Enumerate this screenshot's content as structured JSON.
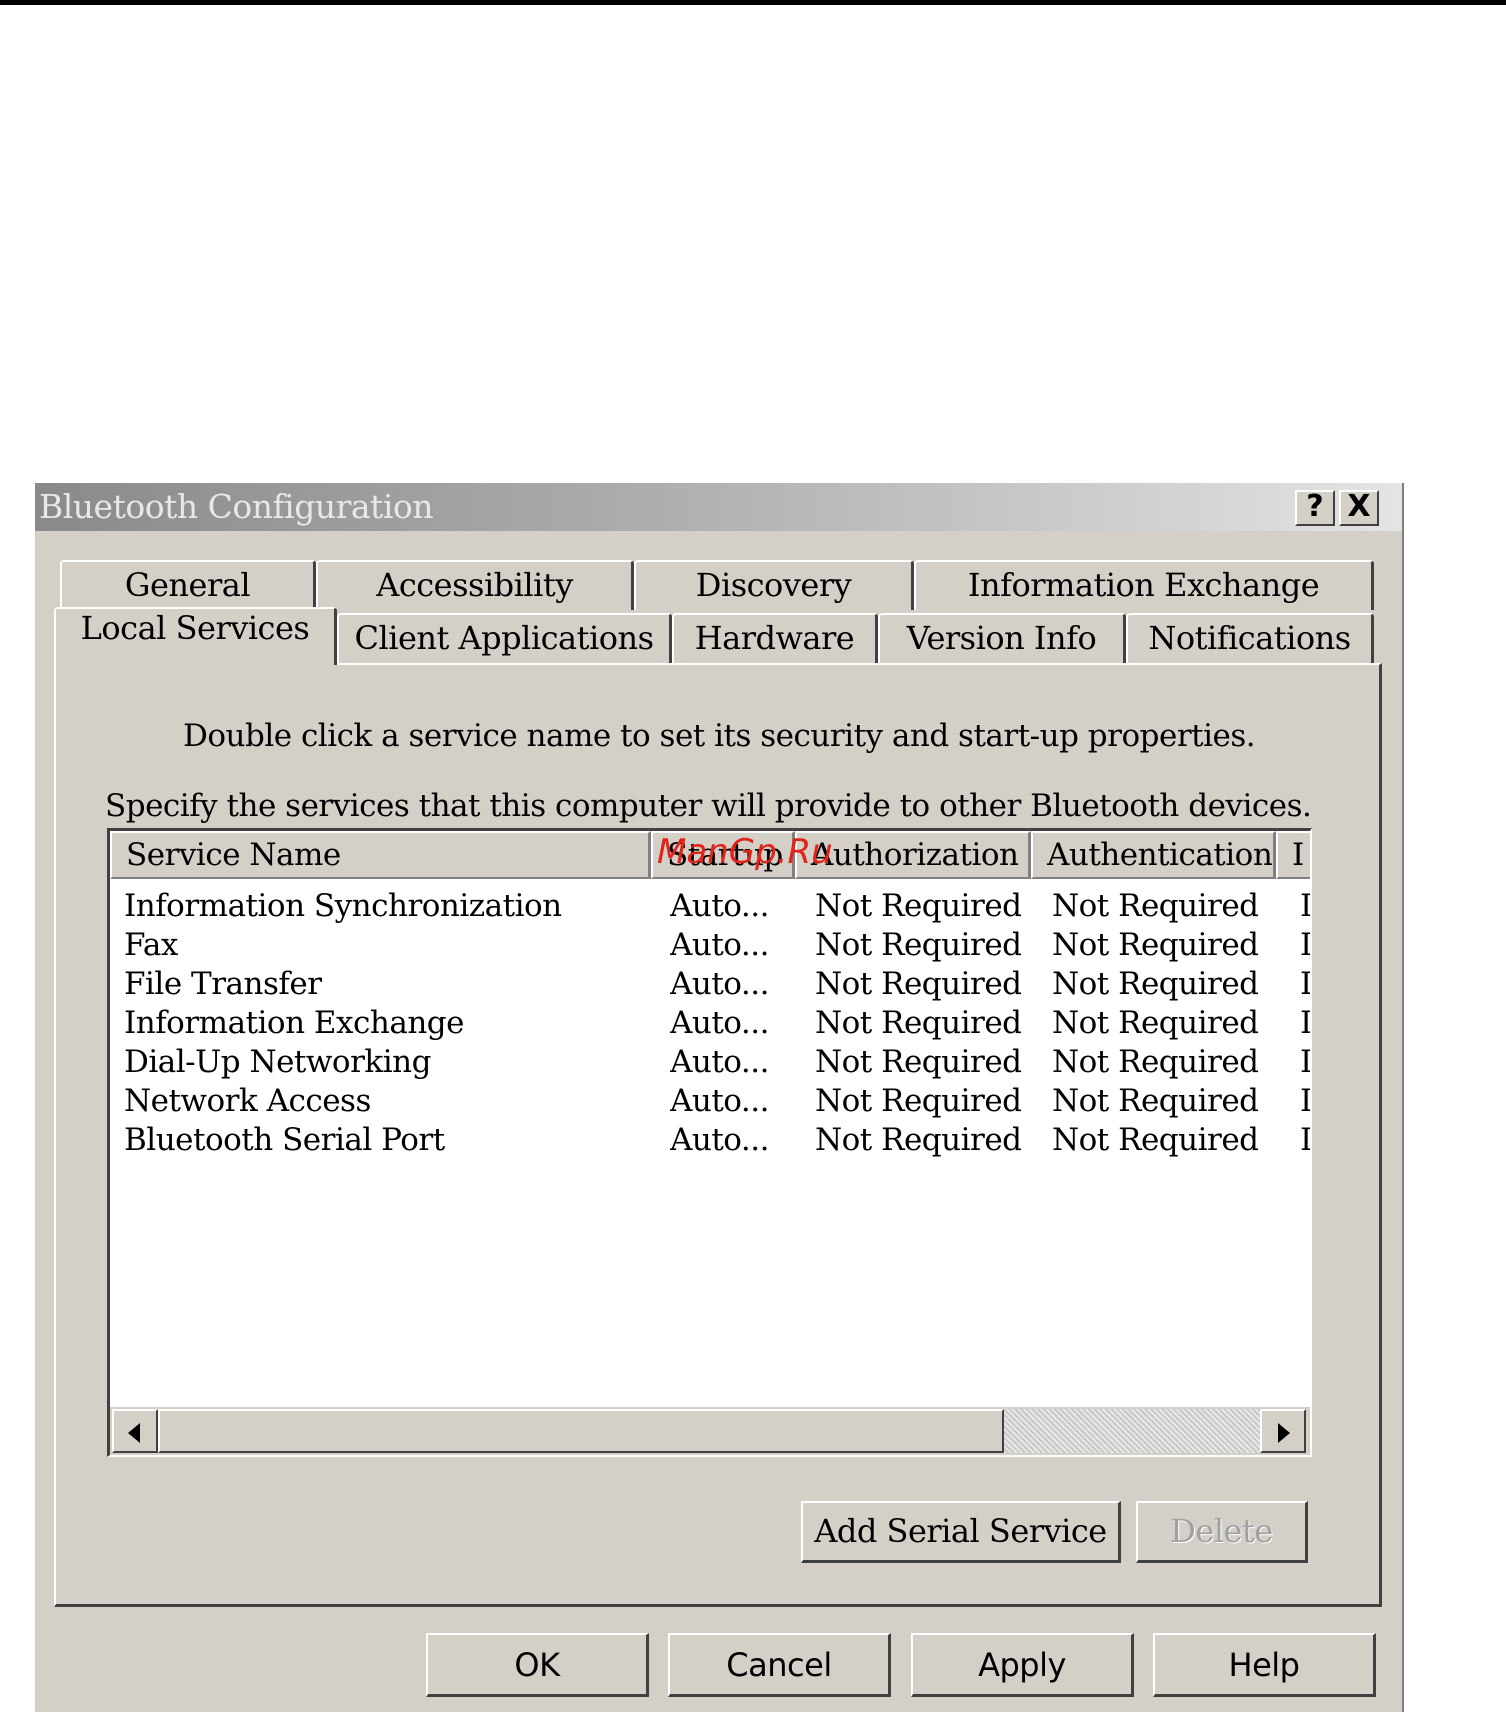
{
  "window": {
    "title": "Bluetooth Configuration",
    "help_button": "?",
    "close_button": "X"
  },
  "tabs_back_row": [
    "General",
    "Accessibility",
    "Discovery",
    "Information Exchange"
  ],
  "tabs_front_row": [
    "Local Services",
    "Client Applications",
    "Hardware",
    "Version Info",
    "Notifications"
  ],
  "active_tab": "Local Services",
  "panel": {
    "instruction": "Double click a service name to set its security and start-up properties.",
    "description": "Specify the services that this computer will provide to other Bluetooth devices."
  },
  "table": {
    "columns": [
      "Service Name",
      "Startup",
      "Authorization",
      "Authentication",
      "I"
    ],
    "rows": [
      [
        "Information Synchronization",
        "Auto...",
        "Not Required",
        "Not Required",
        "I"
      ],
      [
        "Fax",
        "Auto...",
        "Not Required",
        "Not Required",
        "I"
      ],
      [
        "File Transfer",
        "Auto...",
        "Not Required",
        "Not Required",
        "I"
      ],
      [
        "Information Exchange",
        "Auto...",
        "Not Required",
        "Not Required",
        "I"
      ],
      [
        "Dial-Up Networking",
        "Auto...",
        "Not Required",
        "Not Required",
        "I"
      ],
      [
        "Network Access",
        "Auto...",
        "Not Required",
        "Not Required",
        "I"
      ],
      [
        "Bluetooth Serial Port",
        "Auto...",
        "Not Required",
        "Not Required",
        "I"
      ]
    ]
  },
  "buttons": {
    "add_serial_service": "Add Serial Service",
    "delete": "Delete",
    "ok": "OK",
    "cancel": "Cancel",
    "apply": "Apply",
    "help": "Help"
  },
  "watermark": "ManGp.Ru",
  "colors": {
    "dialog_face": "#d4d0c8",
    "watermark": "#e2231a"
  }
}
